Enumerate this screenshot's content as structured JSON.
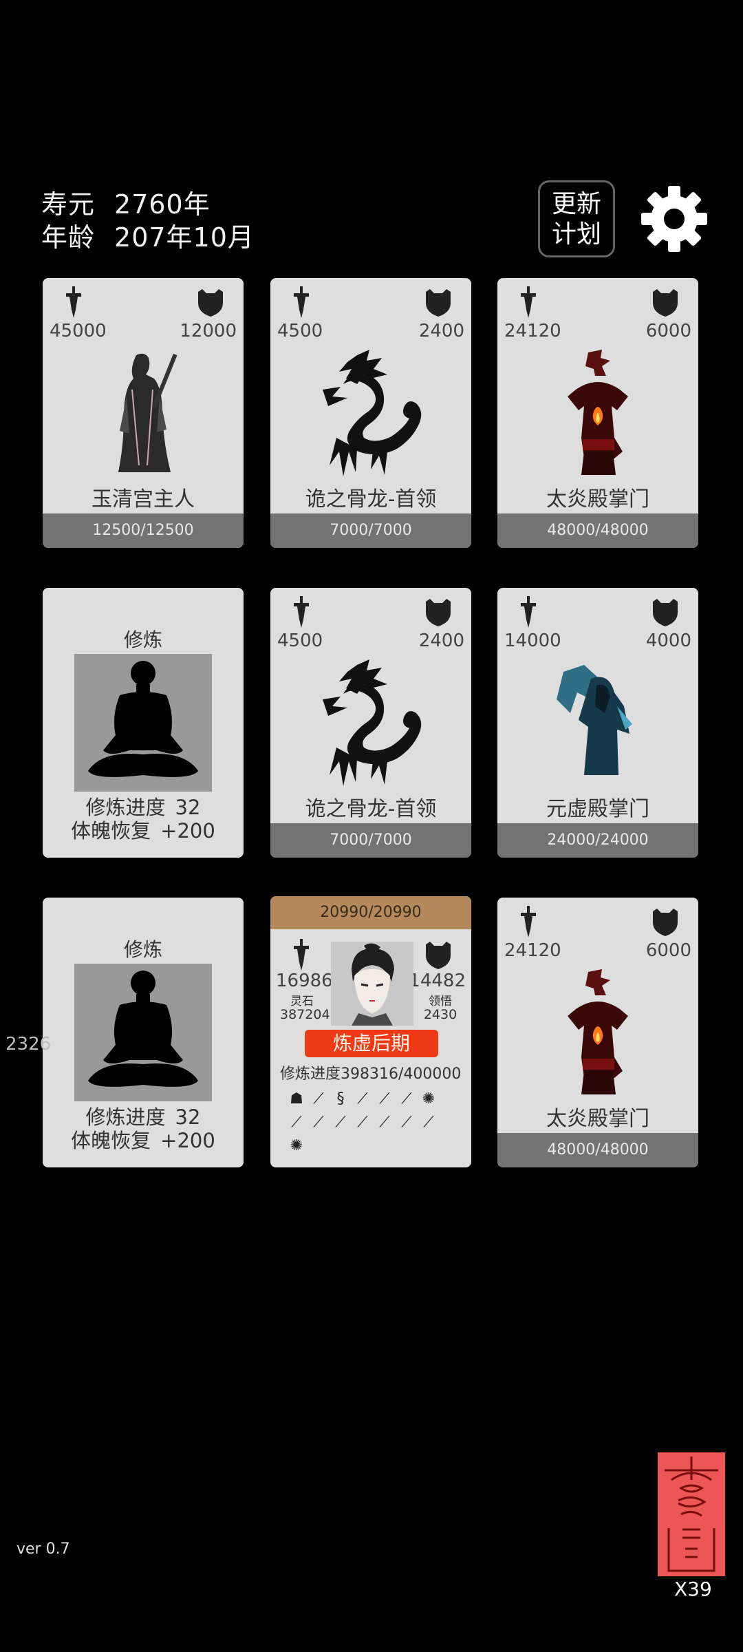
{
  "header": {
    "lifespan_label": "寿元",
    "lifespan_value": "2760年",
    "age_label": "年龄",
    "age_value": "207年10月",
    "update_button_line1": "更新",
    "update_button_line2": "计划"
  },
  "cards": [
    {
      "atk": "45000",
      "def": "12000",
      "name": "玉清宫主人",
      "hp": "12500/12500",
      "icon": "sword-master-icon"
    },
    {
      "atk": "4500",
      "def": "2400",
      "name": "诡之骨龙-首领",
      "hp": "7000/7000",
      "icon": "bone-dragon-icon"
    },
    {
      "atk": "24120",
      "def": "6000",
      "name": "太炎殿掌门",
      "hp": "48000/48000",
      "icon": "flame-master-icon"
    },
    {
      "title": "修炼",
      "progress_label": "修炼进度",
      "progress_value": "32",
      "recover_label": "体魄恢复",
      "recover_value": "+200"
    },
    {
      "atk": "4500",
      "def": "2400",
      "name": "诡之骨龙-首领",
      "hp": "7000/7000",
      "icon": "bone-dragon-icon"
    },
    {
      "atk": "14000",
      "def": "4000",
      "name": "元虚殿掌门",
      "hp": "24000/24000",
      "icon": "void-master-icon"
    },
    {
      "title": "修炼",
      "progress_label": "修炼进度",
      "progress_value": "32",
      "recover_label": "体魄恢复",
      "recover_value": "+200"
    },
    {
      "atk": "24120",
      "def": "6000",
      "name": "太炎殿掌门",
      "hp": "48000/48000",
      "icon": "flame-master-icon"
    }
  ],
  "player": {
    "hp": "20990/20990",
    "atk": "16986",
    "def": "14482",
    "stone_label": "灵石",
    "stone_value": "387204",
    "insight_label": "领悟",
    "insight_value": "2430",
    "realm": "炼虚后期",
    "progress_label": "修炼进度",
    "progress_value": "398316/400000"
  },
  "side_number": "2326",
  "version": "ver 0.7",
  "talisman_count": "X39",
  "colors": {
    "realm_badge": "#ef3a17",
    "player_bar": "#b48a5c",
    "talisman": "#ec5656"
  }
}
